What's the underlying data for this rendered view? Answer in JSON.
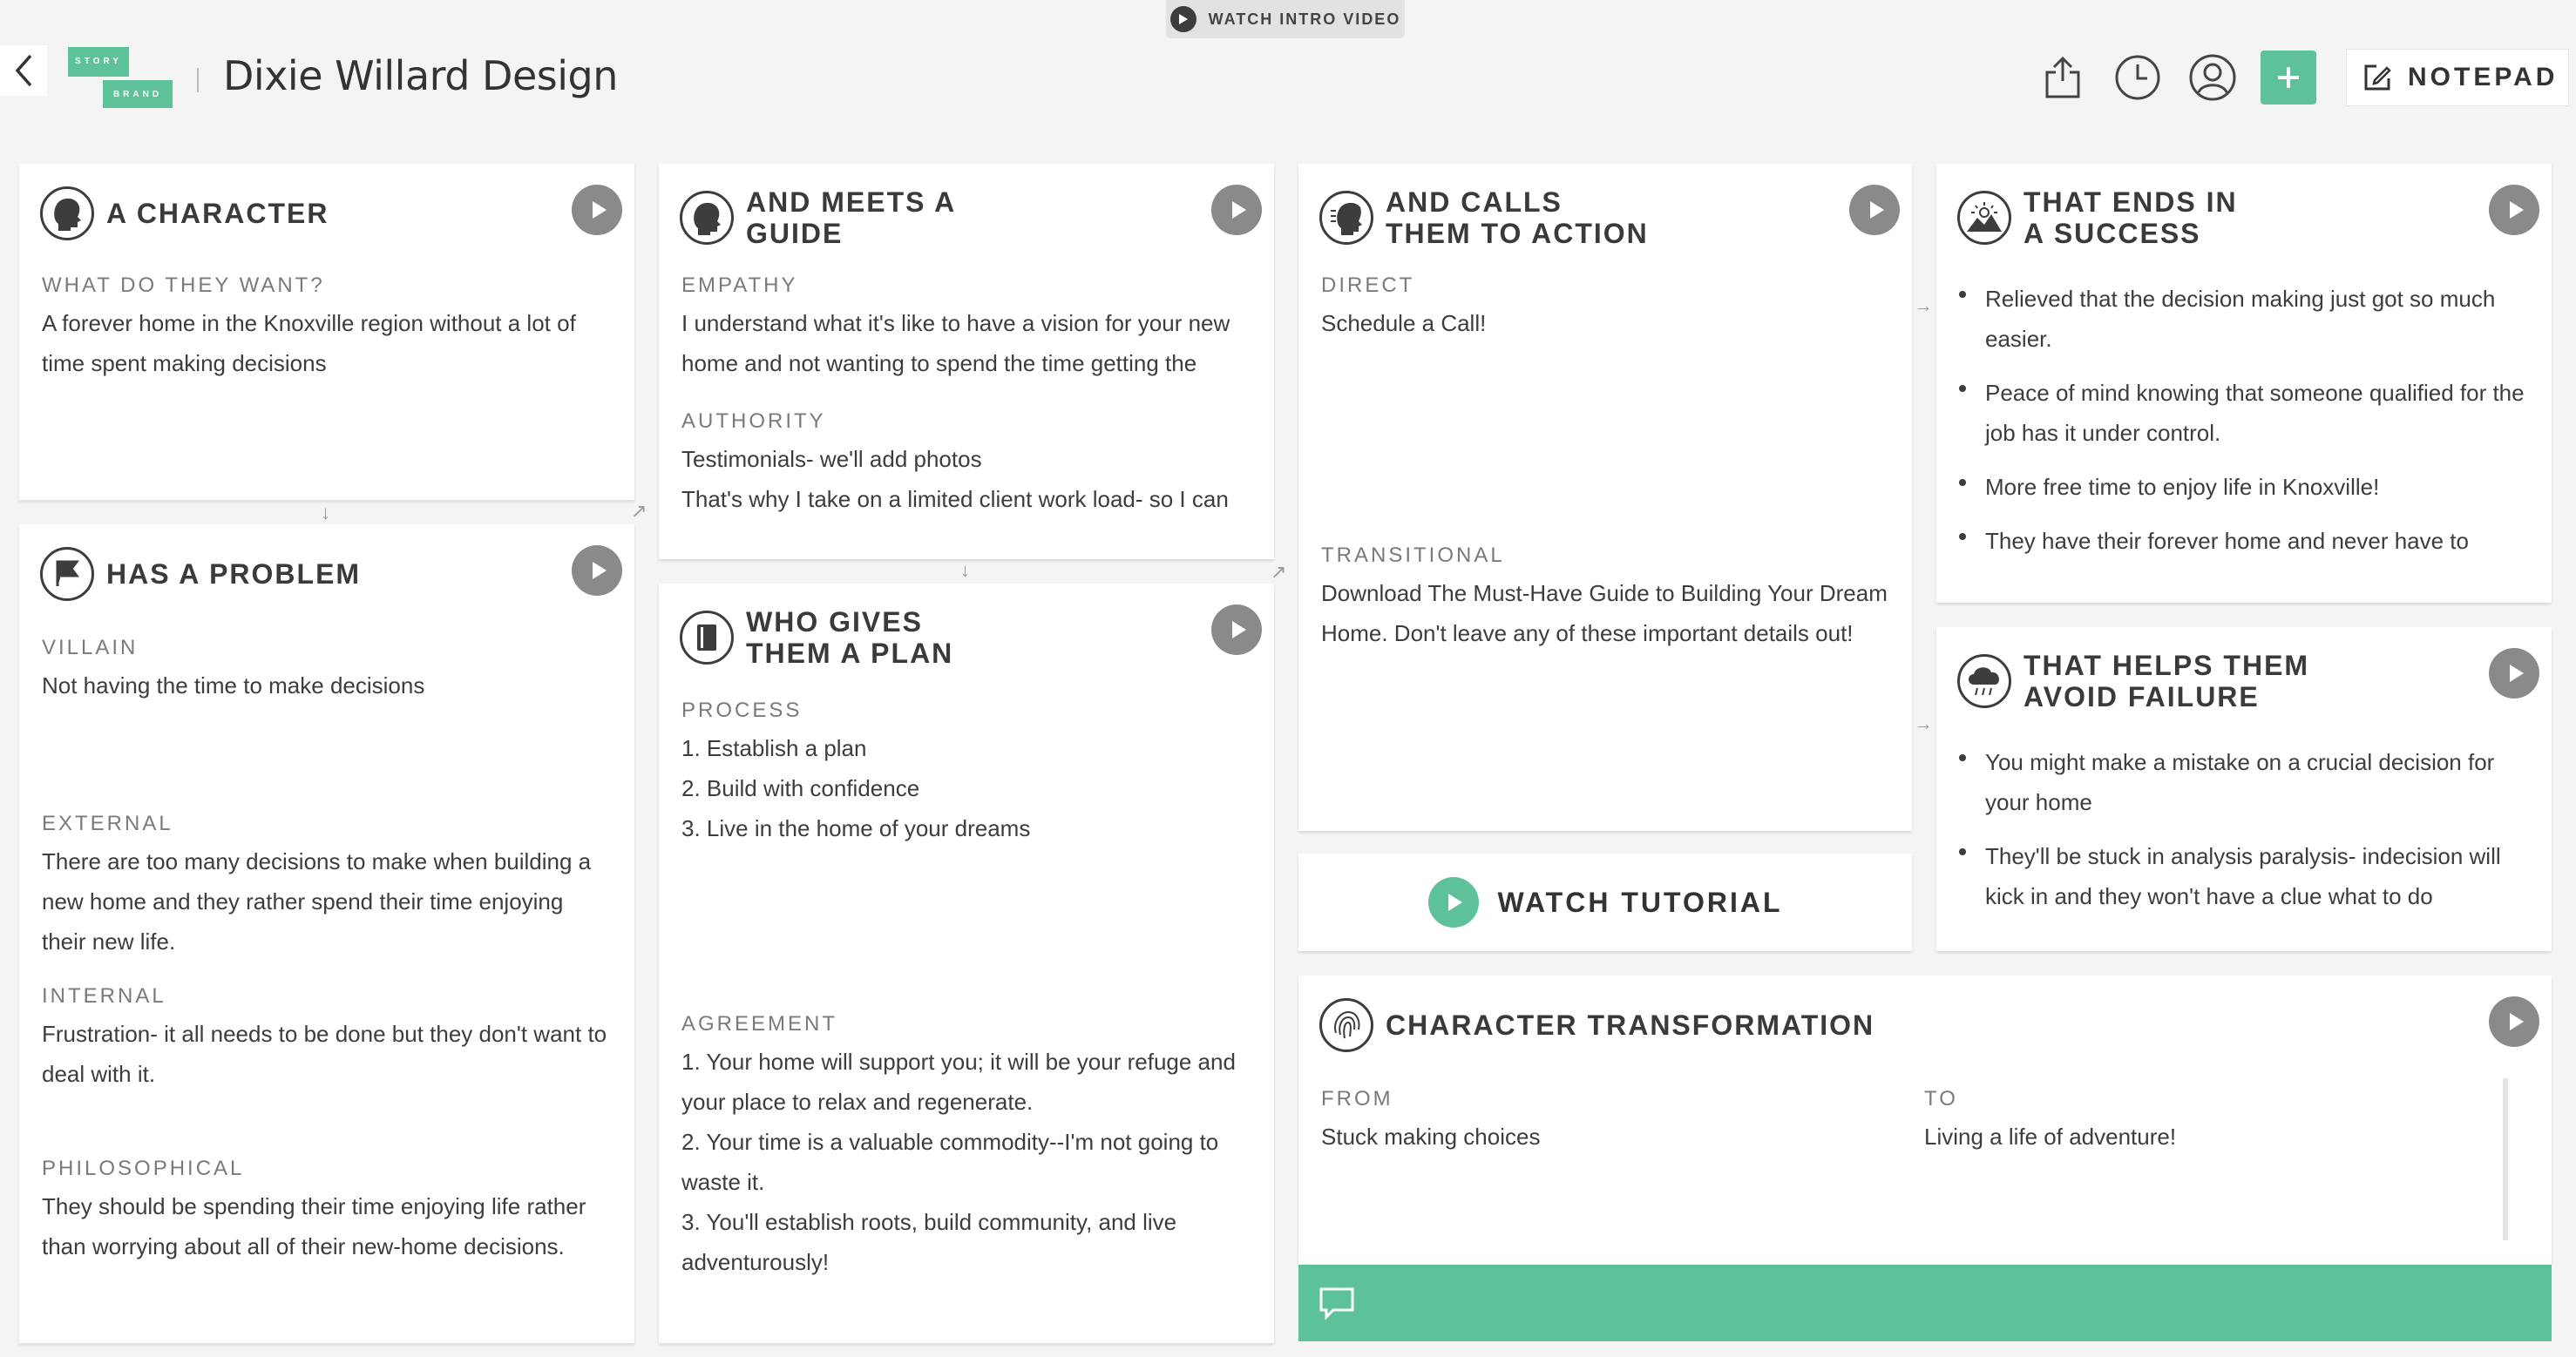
{
  "header": {
    "intro_video_label": "WATCH INTRO VIDEO",
    "logo_top": "STORY",
    "logo_bottom": "BRAND",
    "app_title": "Dixie Willard Design",
    "notepad_label": "NOTEPAD"
  },
  "colors": {
    "accent": "#5dc19a",
    "play": "#8a8a8a",
    "background": "#f4f4f4"
  },
  "cards": {
    "character": {
      "title": "A CHARACTER",
      "fields": [
        {
          "label": "WHAT DO THEY WANT?",
          "value": "A forever home in the Knoxville region without a lot of time spent making decisions"
        }
      ]
    },
    "problem": {
      "title": "HAS A PROBLEM",
      "fields": [
        {
          "label": "VILLAIN",
          "value": "Not having the time to make decisions"
        },
        {
          "label": "EXTERNAL",
          "value": "There are too many decisions to make when building a new home and they rather spend their time enjoying their new life."
        },
        {
          "label": "INTERNAL",
          "value": "Frustration- it all needs to be done but they don't want to deal with it."
        },
        {
          "label": "PHILOSOPHICAL",
          "value": "They should be spending their time enjoying life rather than worrying about all of their new-home decisions."
        }
      ]
    },
    "guide": {
      "title": "AND MEETS A GUIDE",
      "fields": [
        {
          "label": "EMPATHY",
          "value": "I understand what it's like to have a vision for your new home and not wanting to spend the time getting the"
        },
        {
          "label": "AUTHORITY",
          "value_lines": [
            "Testimonials- we'll add photos",
            "That's why I take on a limited client work load- so I can"
          ]
        }
      ]
    },
    "plan": {
      "title_lines": [
        "WHO GIVES",
        "THEM A PLAN"
      ],
      "fields": [
        {
          "label": "PROCESS",
          "value_lines": [
            "1. Establish a plan",
            "2. Build with confidence",
            "3. Live in the home of your dreams"
          ]
        },
        {
          "label": "AGREEMENT",
          "value_lines": [
            "1. Your home will support you; it will be your refuge and your place to relax and regenerate.",
            "2. Your time is a valuable commodity--I'm not going to waste it.",
            "3. You'll  establish roots, build community, and live adventurously!"
          ]
        }
      ]
    },
    "action": {
      "title_lines": [
        "AND CALLS",
        "THEM TO ACTION"
      ],
      "fields": [
        {
          "label": "DIRECT",
          "value": "Schedule a Call!"
        },
        {
          "label": "TRANSITIONAL",
          "value": "Download The Must-Have Guide to Building Your Dream Home. Don't leave any of these important details out!"
        }
      ]
    },
    "success": {
      "title_lines": [
        "THAT ENDS IN",
        "A SUCCESS"
      ],
      "bullets": [
        "Relieved that the decision making just got so much easier.",
        "Peace of mind knowing that someone qualified for the job has it under control.",
        "More free time to enjoy life in Knoxville!",
        "They have their forever home and never have to"
      ]
    },
    "failure": {
      "title_lines": [
        "THAT HELPS THEM",
        "AVOID FAILURE"
      ],
      "bullets": [
        "You might make a mistake on a crucial decision for your home",
        "They'll be stuck in analysis paralysis- indecision will kick in and they won't have a clue what to do"
      ]
    },
    "transformation": {
      "title": "CHARACTER TRANSFORMATION",
      "from_label": "FROM",
      "from_value": "Stuck making choices",
      "to_label": "TO",
      "to_value": "Living a life of adventure!"
    }
  },
  "tutorial": {
    "label": "WATCH TUTORIAL"
  }
}
